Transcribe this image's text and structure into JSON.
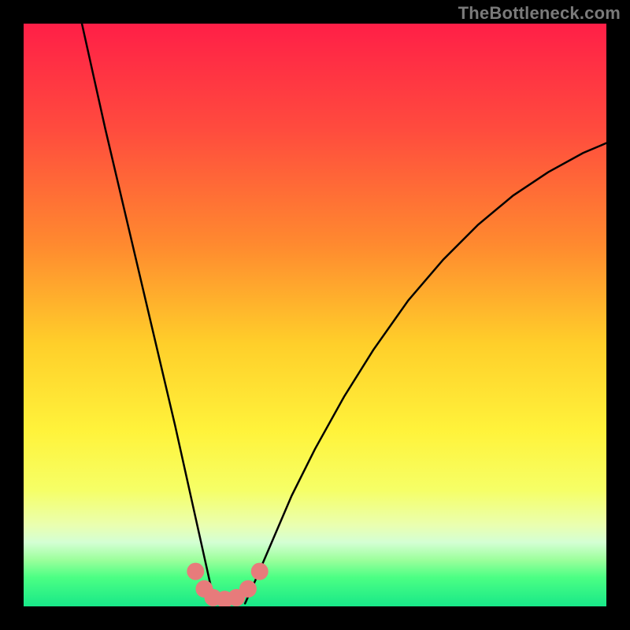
{
  "watermark": "TheBottleneck.com",
  "chart_data": {
    "type": "line",
    "title": "",
    "xlabel": "",
    "ylabel": "",
    "xlim": [
      0,
      100
    ],
    "ylim": [
      0,
      100
    ],
    "grid": false,
    "gradient_stops": [
      {
        "offset": 0,
        "color": "#ff1f47"
      },
      {
        "offset": 18,
        "color": "#ff4b3e"
      },
      {
        "offset": 38,
        "color": "#ff8a2f"
      },
      {
        "offset": 55,
        "color": "#ffcf2a"
      },
      {
        "offset": 70,
        "color": "#fff33b"
      },
      {
        "offset": 80,
        "color": "#f6ff66"
      },
      {
        "offset": 86,
        "color": "#eaffaf"
      },
      {
        "offset": 89,
        "color": "#d4ffd4"
      },
      {
        "offset": 92,
        "color": "#9cff9c"
      },
      {
        "offset": 95,
        "color": "#4cff84"
      },
      {
        "offset": 100,
        "color": "#18e888"
      }
    ],
    "series": [
      {
        "name": "left-curve",
        "stroke": "#000000",
        "width": 2.5,
        "x": [
          10,
          12,
          14,
          16,
          18,
          20,
          22,
          24,
          26,
          27,
          28,
          29,
          30,
          31,
          32,
          33
        ],
        "y": [
          100,
          91,
          82,
          73.5,
          65,
          56.5,
          48,
          39.5,
          31,
          26.5,
          22,
          17.5,
          13,
          8.5,
          4,
          0.5
        ]
      },
      {
        "name": "right-curve",
        "stroke": "#000000",
        "width": 2.5,
        "x": [
          38,
          40,
          43,
          46,
          50,
          55,
          60,
          66,
          72,
          78,
          84,
          90,
          96,
          100
        ],
        "y": [
          0.5,
          5,
          12,
          19,
          27,
          36,
          44,
          52.5,
          59.5,
          65.5,
          70.5,
          74.5,
          77.8,
          79.5
        ]
      },
      {
        "name": "bottom-markers",
        "type": "scatter",
        "color": "#e77b7b",
        "radius": 11,
        "x": [
          29.5,
          31,
          32.5,
          34.5,
          36.5,
          38.5,
          40.5
        ],
        "y": [
          6,
          3,
          1.5,
          1.2,
          1.5,
          3,
          6
        ]
      }
    ]
  }
}
